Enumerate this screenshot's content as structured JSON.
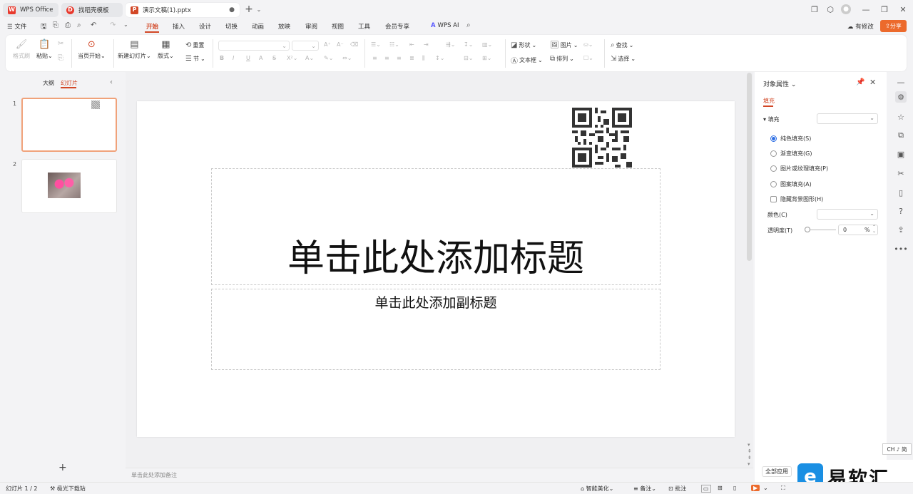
{
  "tabs": [
    {
      "label": "WPS Office",
      "icon": "wps-logo"
    },
    {
      "label": "找稻壳模板",
      "icon": "docer-logo"
    },
    {
      "label": "演示文稿(1).pptx",
      "icon": "ppt-logo"
    }
  ],
  "menu": {
    "file": "文件",
    "items": [
      "开始",
      "插入",
      "设计",
      "切换",
      "动画",
      "放映",
      "审阅",
      "视图",
      "工具",
      "会员专享"
    ],
    "wps_ai": "WPS AI",
    "modified": "有修改",
    "share": "分享"
  },
  "ribbon": {
    "format_painter": "格式刷",
    "paste": "粘贴",
    "from_current": "当页开始",
    "new_slide": "新建幻灯片",
    "layout": "版式",
    "reset": "重置",
    "section": "节",
    "shape": "形状",
    "picture": "图片",
    "textbox": "文本框",
    "arrange": "排列",
    "find": "查找",
    "select": "选择"
  },
  "left_panel": {
    "outline": "大纲",
    "slides": "幻灯片",
    "slide_numbers": [
      "1",
      "2"
    ]
  },
  "slide": {
    "title_placeholder": "单击此处添加标题",
    "subtitle_placeholder": "单击此处添加副标题"
  },
  "notes_placeholder": "单击此处添加备注",
  "props": {
    "title": "对象属性",
    "tab": "填充",
    "fill_label": "填充",
    "options": [
      "纯色填充(S)",
      "渐变填充(G)",
      "图片或纹理填充(P)",
      "图案填充(A)"
    ],
    "hide_bg": "隐藏背景图形(H)",
    "color_label": "颜色(C)",
    "transparency_label": "透明度(T)",
    "transparency_value": "0",
    "percent": "%",
    "apply_all": "全部应用"
  },
  "ime": "CH ♪ 简",
  "watermark": "易软汇",
  "status": {
    "slide_count": "幻灯片 1 / 2",
    "font_source": "极光下载站",
    "smart": "智能美化",
    "notes": "备注",
    "comment": "批注"
  },
  "colors": {
    "accent": "#d24726",
    "brand_ppt": "#d24726",
    "selection": "#f0a27a"
  }
}
